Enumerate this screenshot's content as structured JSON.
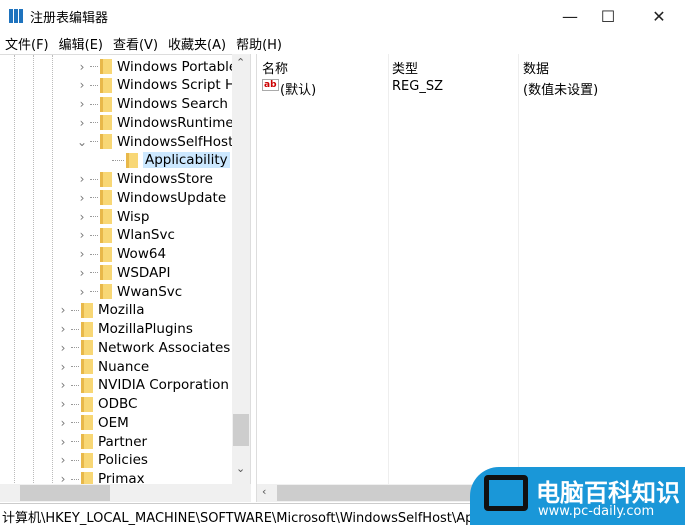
{
  "window": {
    "title": "注册表编辑器",
    "minimize": "—",
    "maximize": "☐",
    "close": "✕"
  },
  "menu": [
    "文件(F)",
    "编辑(E)",
    "查看(V)",
    "收藏夹(A)",
    "帮助(H)"
  ],
  "tree": [
    {
      "label": "Windows Portable",
      "level": 2,
      "state": "collapsed"
    },
    {
      "label": "Windows Script H",
      "level": 2,
      "state": "collapsed"
    },
    {
      "label": "Windows Search",
      "level": 2,
      "state": "collapsed"
    },
    {
      "label": "WindowsRuntime",
      "level": 2,
      "state": "collapsed"
    },
    {
      "label": "WindowsSelfHost",
      "level": 2,
      "state": "expanded"
    },
    {
      "label": "Applicability",
      "level": 3,
      "state": "leaf",
      "selected": true
    },
    {
      "label": "WindowsStore",
      "level": 2,
      "state": "collapsed"
    },
    {
      "label": "WindowsUpdate",
      "level": 2,
      "state": "collapsed"
    },
    {
      "label": "Wisp",
      "level": 2,
      "state": "collapsed"
    },
    {
      "label": "WlanSvc",
      "level": 2,
      "state": "collapsed"
    },
    {
      "label": "Wow64",
      "level": 2,
      "state": "collapsed"
    },
    {
      "label": "WSDAPI",
      "level": 2,
      "state": "collapsed"
    },
    {
      "label": "WwanSvc",
      "level": 2,
      "state": "collapsed"
    },
    {
      "label": "Mozilla",
      "level": 1,
      "state": "collapsed"
    },
    {
      "label": "MozillaPlugins",
      "level": 1,
      "state": "collapsed"
    },
    {
      "label": "Network Associates",
      "level": 1,
      "state": "collapsed"
    },
    {
      "label": "Nuance",
      "level": 1,
      "state": "collapsed"
    },
    {
      "label": "NVIDIA Corporation",
      "level": 1,
      "state": "collapsed"
    },
    {
      "label": "ODBC",
      "level": 1,
      "state": "collapsed"
    },
    {
      "label": "OEM",
      "level": 1,
      "state": "collapsed"
    },
    {
      "label": "Partner",
      "level": 1,
      "state": "collapsed"
    },
    {
      "label": "Policies",
      "level": 1,
      "state": "collapsed"
    },
    {
      "label": "Primax",
      "level": 1,
      "state": "collapsed"
    }
  ],
  "values": {
    "headers": [
      "名称",
      "类型",
      "数据"
    ],
    "rows": [
      {
        "icon": "ab",
        "name": "(默认)",
        "type": "REG_SZ",
        "data": "(数值未设置)"
      }
    ]
  },
  "status": "计算机\\HKEY_LOCAL_MACHINE\\SOFTWARE\\Microsoft\\WindowsSelfHost\\Applicability",
  "watermark": {
    "title": "电脑百科知识",
    "url": "www.pc-daily.com"
  }
}
